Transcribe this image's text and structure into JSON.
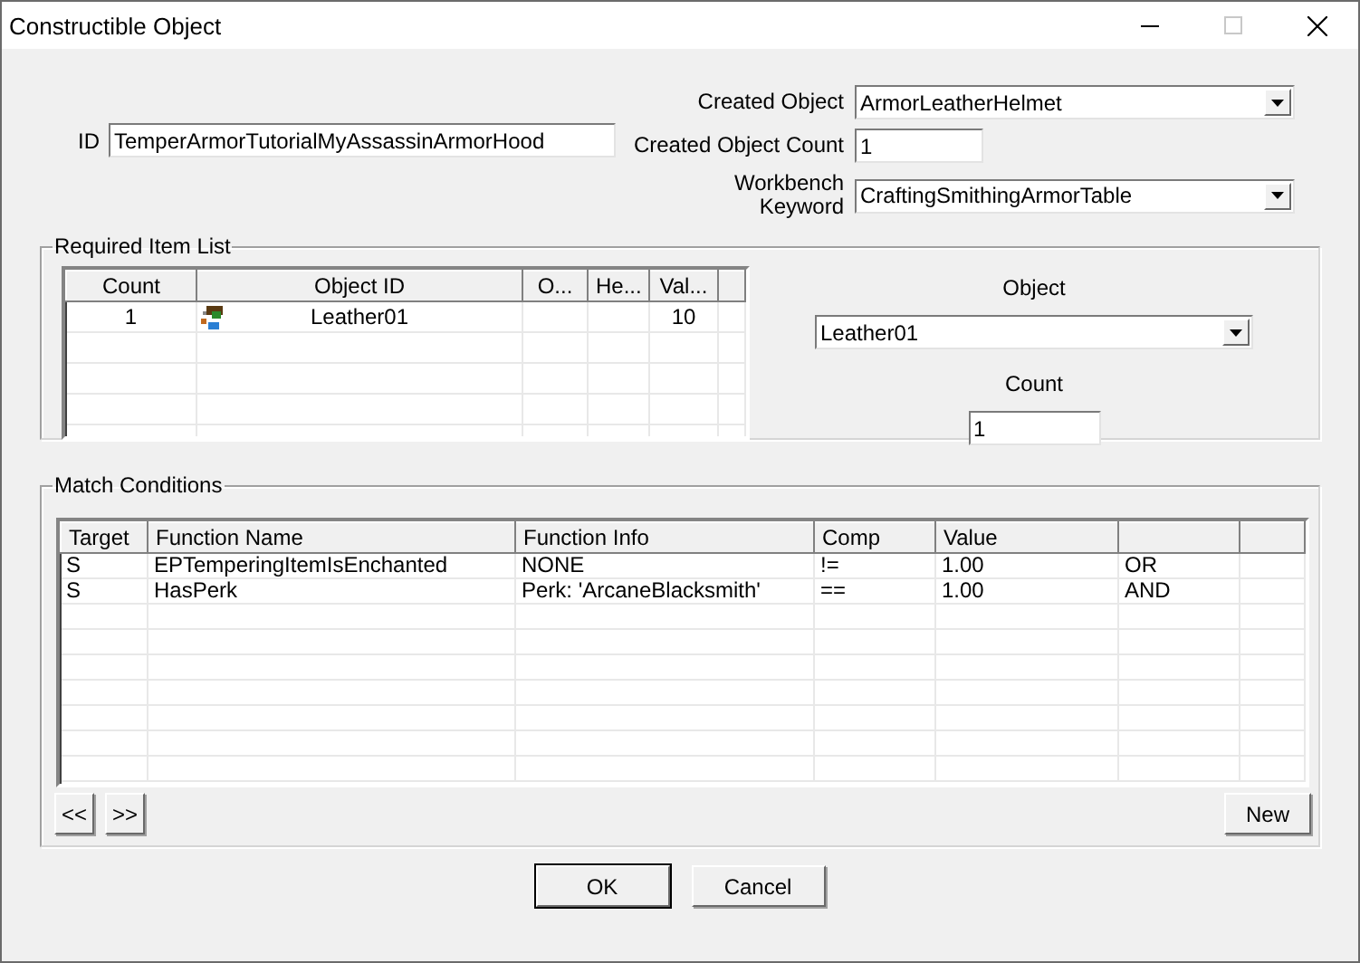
{
  "window": {
    "title": "Constructible Object"
  },
  "id_field": {
    "label": "ID",
    "value": "TemperArmorTutorialMyAssassinArmorHood"
  },
  "created_fields": [
    {
      "kind": "dropdown",
      "label": "Created Object",
      "value": "ArmorLeatherHelmet"
    },
    {
      "kind": "text",
      "label": "Created Object Count",
      "value": "1"
    },
    {
      "kind": "dropdown",
      "label": "Workbench\nKeyword",
      "value": "CraftingSmithingArmorTable"
    }
  ],
  "required_items": {
    "title": "Required Item List",
    "columns": [
      "Count",
      "Object ID",
      "O...",
      "He...",
      "Val..."
    ],
    "rows": [
      {
        "cells": [
          "1",
          "Leather01",
          null,
          null,
          "10"
        ]
      }
    ],
    "object": {
      "label": "Object",
      "value": "Leather01"
    },
    "count": {
      "label": "Count",
      "value": "1"
    }
  },
  "match_conditions": {
    "title": "Match Conditions",
    "columns": [
      "Target",
      "Function Name",
      "Function Info",
      "Comp",
      "Value"
    ],
    "rows": [
      {
        "cells": [
          "S",
          "EPTemperingItemIsEnchanted",
          "NONE",
          "!=",
          "1.00",
          "OR"
        ]
      },
      {
        "cells": [
          "S",
          "HasPerk",
          "Perk: 'ArcaneBlacksmith'",
          "==",
          "1.00",
          "AND"
        ]
      }
    ],
    "nav_buttons": [
      "<<",
      ">>"
    ],
    "new_button": "New"
  },
  "footer_buttons": [
    {
      "label": "OK",
      "default": true
    },
    {
      "label": "Cancel",
      "default": false
    }
  ]
}
